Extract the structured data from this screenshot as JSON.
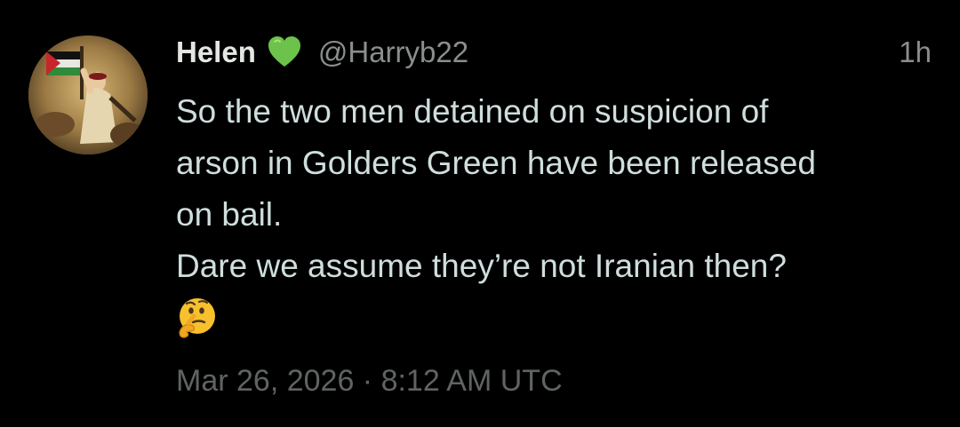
{
  "tweet": {
    "display_name": "Helen",
    "handle": "@Harryb22",
    "relative_time": "1h",
    "text_lines": [
      "So the two men detained on suspicion of",
      "arson in Golders Green have been released",
      "on bail.",
      "Dare we assume they’re not Iranian then?"
    ],
    "emoji_name": "thinking-face",
    "timestamp": "Mar 26, 2026 · 8:12 AM UTC",
    "badge_icon": "green-heart",
    "avatar_icon": "profile-painting"
  },
  "colors": {
    "background": "#000000",
    "name": "#e4e6e3",
    "handle": "#8a8e8c",
    "text": "#cfdedd",
    "timestamp": "#5f6462",
    "heart": "#6cc24a",
    "emoji": "#f7c12e"
  }
}
